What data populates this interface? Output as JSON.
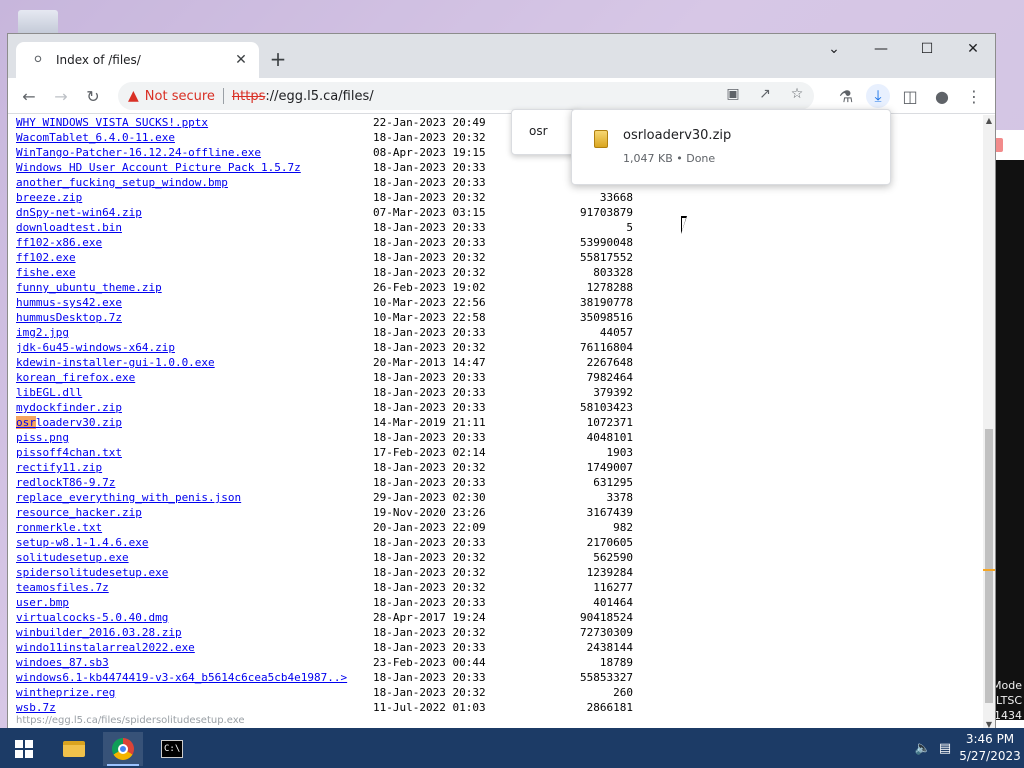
{
  "desktop": {
    "watermark_lines": [
      "Mode",
      "LTSC",
      "1434"
    ]
  },
  "browser": {
    "tab_title": "Index of /files/",
    "security_label": "Not secure",
    "url_scheme": "https",
    "url_rest": "://egg.l5.ca/files/",
    "icons": {
      "back": "back-arrow-icon",
      "forward": "forward-arrow-icon",
      "reload": "reload-icon",
      "warning": "warning-icon"
    }
  },
  "findbar": {
    "query": "osr"
  },
  "download": {
    "filename": "osrloaderv30.zip",
    "status": "1,047 KB • Done"
  },
  "listing": [
    {
      "name": "WHY WINDOWS VISTA SUCKS!.pptx",
      "date": "22-Jan-2023 20:49",
      "size": ""
    },
    {
      "name": "WacomTablet_6.4.0-11.exe",
      "date": "18-Jan-2023 20:32",
      "size": ""
    },
    {
      "name": "WinTango-Patcher-16.12.24-offline.exe",
      "date": "08-Apr-2023 19:15",
      "size": ""
    },
    {
      "name": "Windows HD User Account Picture Pack 1.5.7z",
      "date": "18-Jan-2023 20:33",
      "size": ""
    },
    {
      "name": "another_fucking_setup_window.bmp",
      "date": "18-Jan-2023 20:33",
      "size": ""
    },
    {
      "name": "breeze.zip",
      "date": "18-Jan-2023 20:32",
      "size": "33668"
    },
    {
      "name": "dnSpy-net-win64.zip",
      "date": "07-Mar-2023 03:15",
      "size": "91703879"
    },
    {
      "name": "downloadtest.bin",
      "date": "18-Jan-2023 20:33",
      "size": "5"
    },
    {
      "name": "ff102-x86.exe",
      "date": "18-Jan-2023 20:33",
      "size": "53990048"
    },
    {
      "name": "ff102.exe",
      "date": "18-Jan-2023 20:32",
      "size": "55817552"
    },
    {
      "name": "fishe.exe",
      "date": "18-Jan-2023 20:32",
      "size": "803328"
    },
    {
      "name": "funny_ubuntu_theme.zip",
      "date": "26-Feb-2023 19:02",
      "size": "1278288"
    },
    {
      "name": "hummus-sys42.exe",
      "date": "10-Mar-2023 22:56",
      "size": "38190778"
    },
    {
      "name": "hummusDesktop.7z",
      "date": "10-Mar-2023 22:58",
      "size": "35098516"
    },
    {
      "name": "img2.jpg",
      "date": "18-Jan-2023 20:33",
      "size": "44057"
    },
    {
      "name": "jdk-6u45-windows-x64.zip",
      "date": "18-Jan-2023 20:32",
      "size": "76116804"
    },
    {
      "name": "kdewin-installer-gui-1.0.0.exe",
      "date": "20-Mar-2013 14:47",
      "size": "2267648"
    },
    {
      "name": "korean_firefox.exe",
      "date": "18-Jan-2023 20:33",
      "size": "7982464"
    },
    {
      "name": "libEGL.dll",
      "date": "18-Jan-2023 20:33",
      "size": "379392"
    },
    {
      "name": "mydockfinder.zip",
      "date": "18-Jan-2023 20:33",
      "size": "58103423"
    },
    {
      "name": "osrloaderv30.zip",
      "date": "14-Mar-2019 21:11",
      "size": "1072371",
      "highlight": "osr"
    },
    {
      "name": "piss.png",
      "date": "18-Jan-2023 20:33",
      "size": "4048101"
    },
    {
      "name": "pissoff4chan.txt",
      "date": "17-Feb-2023 02:14",
      "size": "1903"
    },
    {
      "name": "rectify11.zip",
      "date": "18-Jan-2023 20:32",
      "size": "1749007"
    },
    {
      "name": "redlockT86-9.7z",
      "date": "18-Jan-2023 20:33",
      "size": "631295"
    },
    {
      "name": "replace_everything_with_penis.json",
      "date": "29-Jan-2023 02:30",
      "size": "3378"
    },
    {
      "name": "resource_hacker.zip",
      "date": "19-Nov-2020 23:26",
      "size": "3167439"
    },
    {
      "name": "ronmerkle.txt",
      "date": "20-Jan-2023 22:09",
      "size": "982"
    },
    {
      "name": "setup-w8.1-1.4.6.exe",
      "date": "18-Jan-2023 20:33",
      "size": "2170605"
    },
    {
      "name": "solitudesetup.exe",
      "date": "18-Jan-2023 20:32",
      "size": "562590"
    },
    {
      "name": "spidersolitudesetup.exe",
      "date": "18-Jan-2023 20:32",
      "size": "1239284"
    },
    {
      "name": "teamosfiles.7z",
      "date": "18-Jan-2023 20:32",
      "size": "116277"
    },
    {
      "name": "user.bmp",
      "date": "18-Jan-2023 20:33",
      "size": "401464"
    },
    {
      "name": "virtualcocks-5.0.40.dmg",
      "date": "28-Apr-2017 19:24",
      "size": "90418524"
    },
    {
      "name": "winbuilder_2016.03.28.zip",
      "date": "18-Jan-2023 20:32",
      "size": "72730309"
    },
    {
      "name": "windo11instalarreal2022.exe",
      "date": "18-Jan-2023 20:33",
      "size": "2438144"
    },
    {
      "name": "windoes_87.sb3",
      "date": "23-Feb-2023 00:44",
      "size": "18789"
    },
    {
      "name": "windows6.1-kb4474419-v3-x64_b5614c6cea5cb4e1987..>",
      "date": "18-Jan-2023 20:33",
      "size": "55853327"
    },
    {
      "name": "wintheprize.reg",
      "date": "18-Jan-2023 20:32",
      "size": "260"
    },
    {
      "name": "wsb.7z",
      "date": "11-Jul-2022 01:03",
      "size": "2866181"
    }
  ],
  "status_url": "https://egg.l5.ca/files/spidersolitudesetup.exe",
  "taskbar": {
    "time": "3:46 PM",
    "date": "5/27/2023"
  }
}
